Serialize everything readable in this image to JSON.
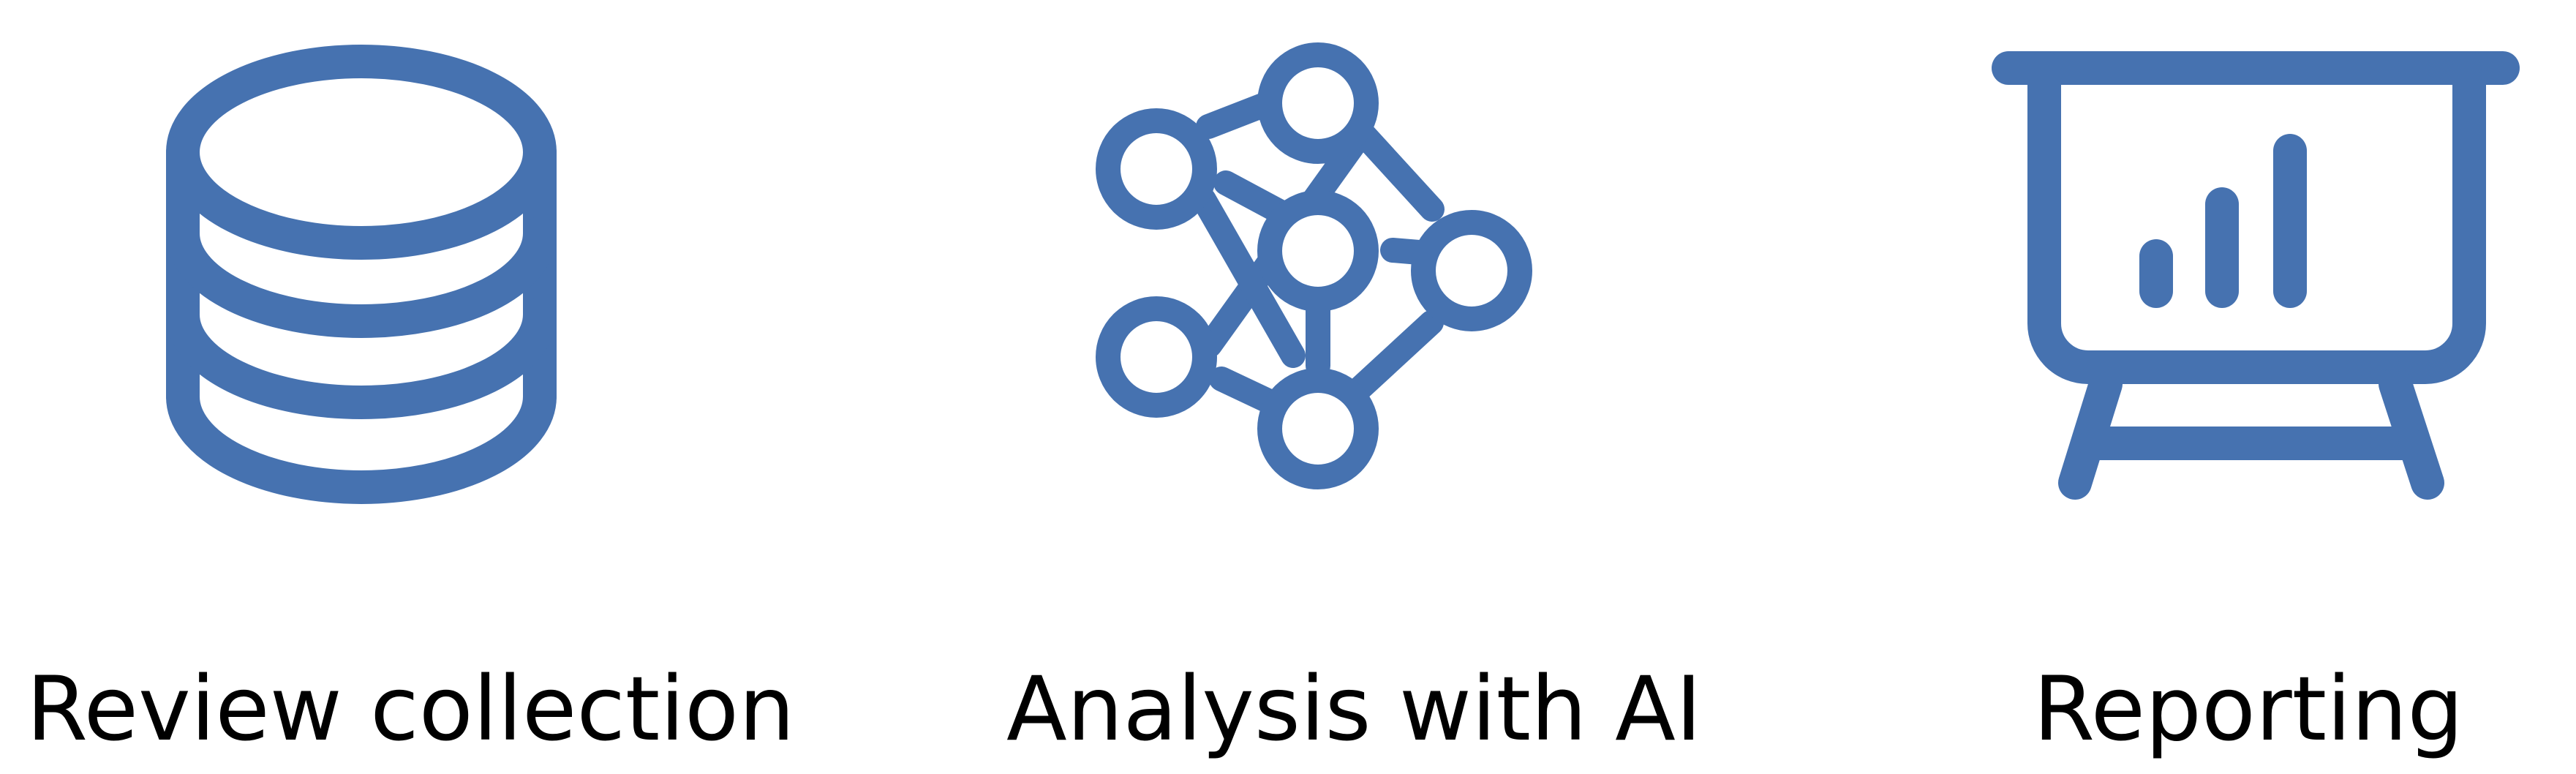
{
  "accent_color": "#4672B0",
  "steps": [
    {
      "label": "Review collection",
      "icon": "database-icon"
    },
    {
      "label": "Analysis with AI",
      "icon": "network-graph-icon"
    },
    {
      "label": "Reporting",
      "icon": "presentation-board-icon"
    }
  ]
}
